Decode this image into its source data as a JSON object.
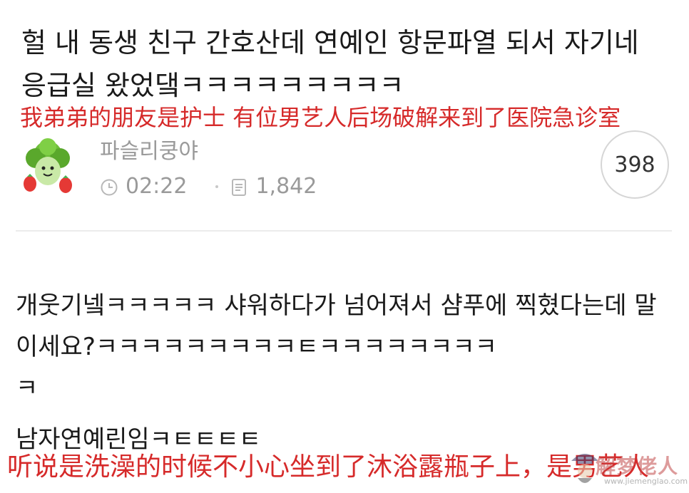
{
  "post": {
    "title": "헐 내 동생 친구 간호산데 연예인 항문파열 되서 자기네 응급실 왔었댘ㅋㅋㅋㅋㅋㅋㅋㅋㅋ",
    "caption_cn": "我弟弟的朋友是护士 有位男艺人后场破解来到了医院急诊室"
  },
  "author": {
    "name": "파슬리쿵야",
    "time": "02:22",
    "views": "1,842",
    "comment_count": "398"
  },
  "comment": {
    "line1": "개웃기넼ㅋㅋㅋㅋㅋ 샤워하다가 넘어져서 샴푸에 찍혔다는데 말이세요?ㅋㅋㅋㅋㅋㅋㅋㅋㅋㅌㅋㅋㅋㅋㅋㅋㅋㅋ",
    "line2": "ㅋ",
    "line3": "남자연예린임ㅋㅌㅌㅌㅌ",
    "caption_cn": "听说是洗澡的时候不小心坐到了沐浴露瓶子上，是男艺人"
  },
  "icons": {
    "time": "clock-icon",
    "views": "document-icon",
    "avatar": "broccoli-character-avatar"
  },
  "colors": {
    "caption_red": "#d62a2a",
    "meta_gray": "#9a9a9a",
    "divider": "#ececec"
  },
  "watermark": {
    "text": "解梦佬人",
    "url": "www.jiemenglao.com"
  }
}
